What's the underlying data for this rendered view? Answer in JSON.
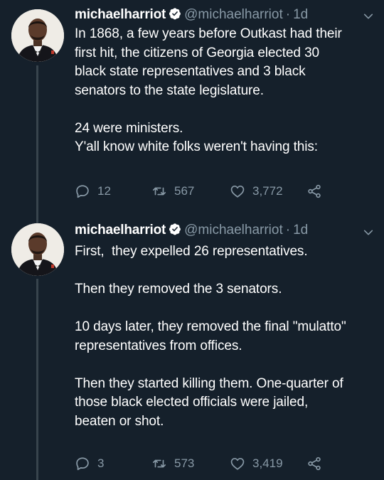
{
  "tweets": [
    {
      "display_name": "michaelharriot",
      "handle": "@michaelharriot",
      "separator": "·",
      "time": "1d",
      "lines": [
        "In 1868, a few years before Outkast had their",
        "first hit, the citizens of Georgia elected 30",
        "black state representatives and 3 black",
        "senators to the state legislature.",
        "",
        "24 were ministers.",
        "Y'all know white folks weren't having this:"
      ],
      "replies": "12",
      "retweets": "567",
      "likes": "3,772"
    },
    {
      "display_name": "michaelharriot",
      "handle": "@michaelharriot",
      "separator": "·",
      "time": "1d",
      "lines": [
        "First,  they expelled 26 representatives.",
        "",
        "Then they removed the 3 senators.",
        "",
        "10 days later, they removed the final \"mulatto\"",
        "representatives from offices.",
        "",
        "Then they started killing them. One-quarter of",
        "those black elected officials were jailed,",
        "beaten or shot."
      ],
      "replies": "3",
      "retweets": "573",
      "likes": "3,419"
    }
  ],
  "icons": {
    "verified": "verified-badge-icon",
    "caret": "chevron-down-icon",
    "reply": "reply-bubble-icon",
    "retweet": "retweet-icon",
    "like": "heart-icon",
    "share": "share-icon"
  },
  "colors": {
    "background": "#15202b",
    "text": "#ffffff",
    "secondary": "#8899a6",
    "thread_line": "#38444d"
  }
}
